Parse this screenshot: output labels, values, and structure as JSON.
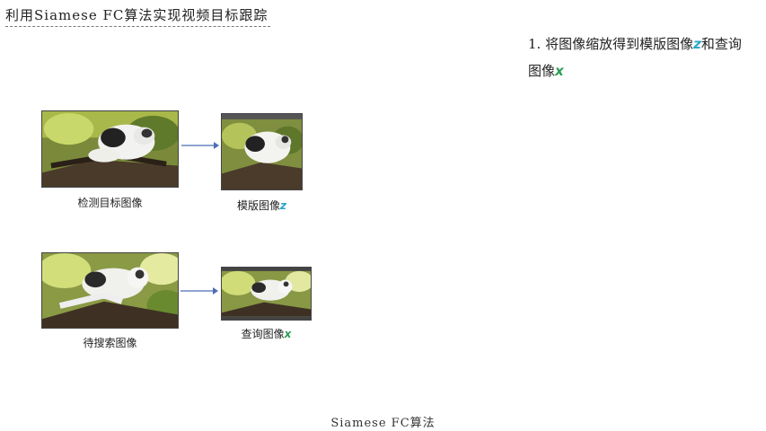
{
  "title": "利用Siamese FC算法实现视频目标跟踪",
  "step": {
    "text": "1. 将图像缩放得到模版图像",
    "var_z": "z",
    "mid": "和查询图像",
    "var_x": "x"
  },
  "images": {
    "detect_target": {
      "caption": "检测目标图像"
    },
    "template": {
      "caption": "模版图像",
      "var": "z"
    },
    "to_track": {
      "caption": "待搜索图像"
    },
    "query": {
      "caption": "查询图像",
      "var": "x"
    }
  },
  "footer": "Siamese FC算法",
  "colors": {
    "var_z": "#27a6c9",
    "var_x": "#2a9d55",
    "arrow": "#4a6fb5"
  }
}
